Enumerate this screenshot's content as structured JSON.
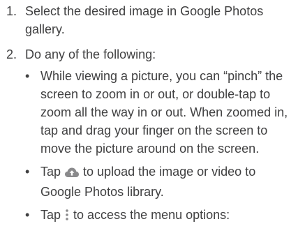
{
  "steps": [
    {
      "number": "1.",
      "text": "Select the desired image in Google Photos gallery."
    },
    {
      "number": "2.",
      "text": "Do any of the following:",
      "bullets": [
        {
          "marker": "•",
          "text": "While viewing a picture, you can “pinch” the screen to zoom in or out, or double-tap to zoom all the way in or out. When zoomed in, tap and drag your finger on the screen to move the picture around on the screen."
        },
        {
          "marker": "•",
          "prefix": "Tap ",
          "icon": "cloud-upload-icon",
          "suffix": " to upload the image or video to Google Photos library."
        },
        {
          "marker": "•",
          "prefix": "Tap ",
          "icon": "more-vert-icon",
          "suffix": " to access the menu options:"
        }
      ]
    }
  ],
  "colors": {
    "text": "#404041",
    "icon": "#8a8a8c"
  }
}
